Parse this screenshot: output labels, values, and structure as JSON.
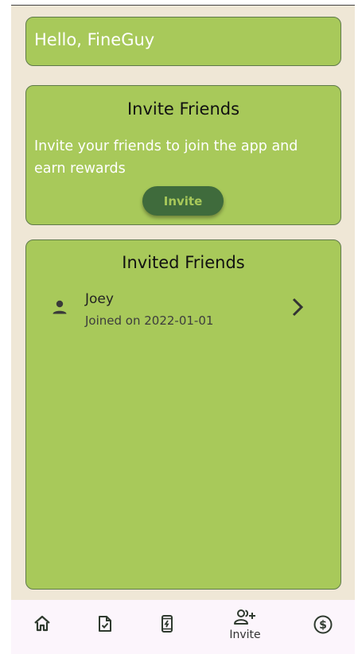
{
  "greeting": "Hello, FineGuy",
  "invite_card": {
    "title": "Invite Friends",
    "description": "Invite your friends to join the app and earn rewards",
    "button_label": "Invite"
  },
  "friends_card": {
    "title": "Invited Friends",
    "friends": [
      {
        "name": "Joey",
        "joined": "Joined on 2022-01-01"
      }
    ]
  },
  "bottom_nav": {
    "items": [
      {
        "icon": "home-icon",
        "label": ""
      },
      {
        "icon": "task-document-icon",
        "label": ""
      },
      {
        "icon": "phone-charging-icon",
        "label": ""
      },
      {
        "icon": "add-person-icon",
        "label": "Invite",
        "active": true
      },
      {
        "icon": "dollar-coin-icon",
        "label": ""
      }
    ]
  },
  "colors": {
    "background": "#efe7d6",
    "card": "#a8c95a",
    "button": "#3f6b3c",
    "nav_background": "#fcf5fc"
  }
}
